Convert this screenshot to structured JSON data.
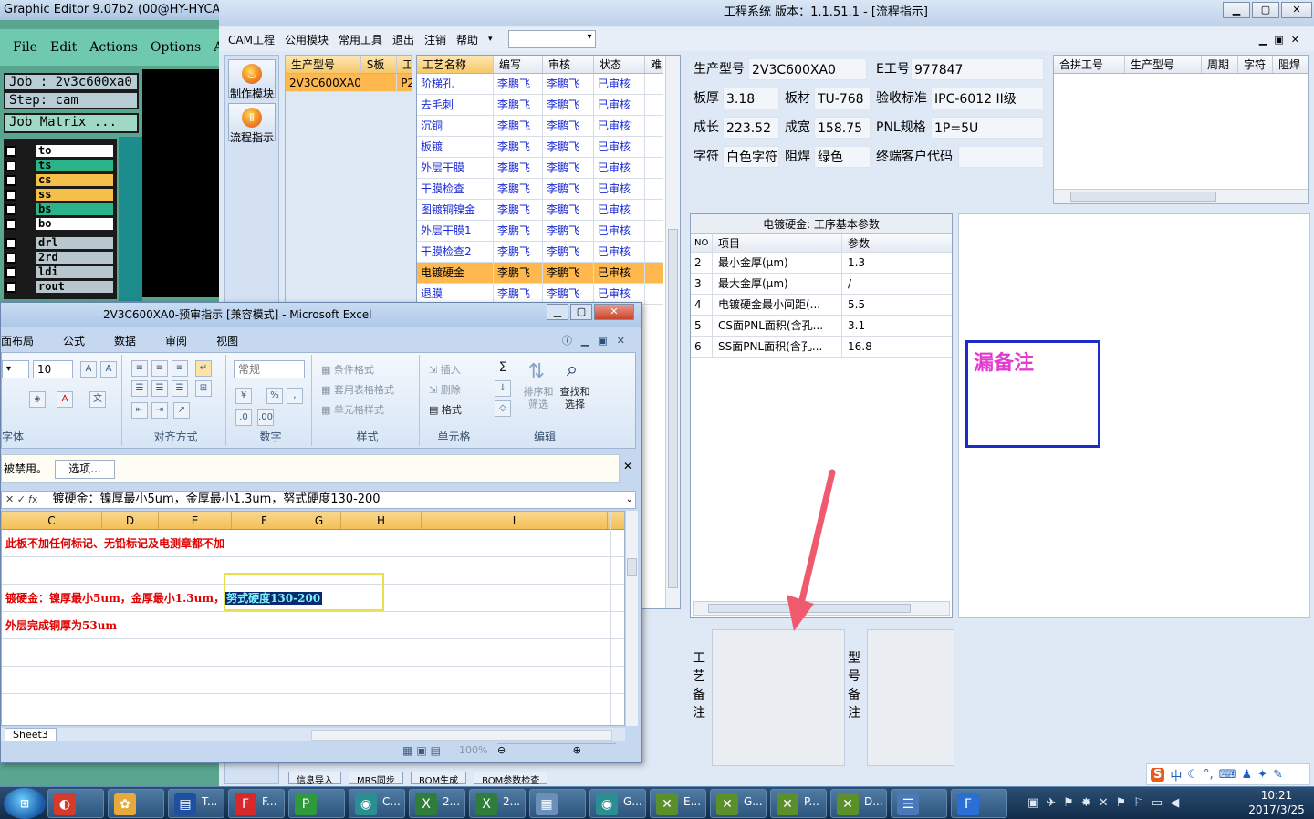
{
  "graphic_editor": {
    "title": "Graphic Editor 9.07b2 (00@HY-HYCA",
    "menu": [
      "File",
      "Edit",
      "Actions",
      "Options",
      "A"
    ],
    "job": "Job  : 2v3c600xa0",
    "step": "Step: cam",
    "matrix": "Job Matrix ...",
    "layers": [
      {
        "name": "to",
        "color": "#ffffff"
      },
      {
        "name": "ts",
        "color": "#2bb48a"
      },
      {
        "name": "cs",
        "color": "#f4c04a"
      },
      {
        "name": "ss",
        "color": "#f4c04a"
      },
      {
        "name": "bs",
        "color": "#2bb48a"
      },
      {
        "name": "bo",
        "color": "#ffffff"
      }
    ],
    "drill_layers": [
      "drl",
      "2rd",
      "ldi",
      "rout"
    ]
  },
  "cam": {
    "title": "工程系统   版本：1.1.51.1 - [流程指示]",
    "menu": [
      "CAM工程",
      "公用模块",
      "常用工具",
      "退出",
      "注销",
      "帮助"
    ],
    "sidebar": [
      {
        "label": "制作模块",
        "icon": "fire-icon"
      },
      {
        "label": "流程指示",
        "icon": "flow-icon"
      }
    ],
    "model_grid": {
      "headers": [
        "生产型号",
        "S板",
        "工"
      ],
      "rows": [
        [
          "2V3C600XA0",
          "",
          "P2"
        ]
      ]
    },
    "process_grid": {
      "headers": [
        "工艺名称",
        "编写",
        "审核",
        "状态",
        "难"
      ],
      "rows": [
        [
          "阶梯孔",
          "李鹏飞",
          "李鹏飞",
          "已审核"
        ],
        [
          "去毛刺",
          "李鹏飞",
          "李鹏飞",
          "已审核"
        ],
        [
          "沉铜",
          "李鹏飞",
          "李鹏飞",
          "已审核"
        ],
        [
          "板镀",
          "李鹏飞",
          "李鹏飞",
          "已审核"
        ],
        [
          "外层干膜",
          "李鹏飞",
          "李鹏飞",
          "已审核"
        ],
        [
          "干膜检查",
          "李鹏飞",
          "李鹏飞",
          "已审核"
        ],
        [
          "图镀铜镍金",
          "李鹏飞",
          "李鹏飞",
          "已审核"
        ],
        [
          "外层干膜1",
          "李鹏飞",
          "李鹏飞",
          "已审核"
        ],
        [
          "干膜检查2",
          "李鹏飞",
          "李鹏飞",
          "已审核"
        ],
        [
          "电镀硬金",
          "李鹏飞",
          "李鹏飞",
          "已审核"
        ],
        [
          "退膜",
          "李鹏飞",
          "李鹏飞",
          "已审核"
        ]
      ],
      "selected_index": 9
    },
    "info": {
      "model_label": "生产型号",
      "model": "2V3C600XA0",
      "eng_label": "E工号",
      "eng": "977847",
      "thick_label": "板厚",
      "thick": "3.18",
      "material_label": "板材",
      "material": "TU-768",
      "standard_label": "验收标准",
      "standard": "IPC-6012 II级",
      "length_label": "成长",
      "length": "223.52",
      "width_label": "成宽",
      "width": "158.75",
      "pnl_label": "PNL规格",
      "pnl": "1P=5U",
      "char_label": "字符",
      "char": "白色字符",
      "mask_label": "阻焊",
      "mask": "绿色",
      "customer_label": "终端客户代码",
      "customer": ""
    },
    "merge_grid": {
      "headers": [
        "合拼工号",
        "生产型号",
        "周期",
        "字符",
        "阻焊"
      ]
    },
    "param_grid": {
      "title": "电镀硬金: 工序基本参数",
      "headers": [
        "NO",
        "项目",
        "参数"
      ],
      "rows": [
        [
          "2",
          "最小金厚(μm)",
          "1.3"
        ],
        [
          "3",
          "最大金厚(μm)",
          "/"
        ],
        [
          "4",
          "电镀硬金最小间距(...",
          "5.5"
        ],
        [
          "5",
          "CS面PNL面积(含孔...",
          "3.1"
        ],
        [
          "6",
          "SS面PNL面积(含孔...",
          "16.8"
        ]
      ]
    },
    "note_text": "漏备注",
    "process_remark_label": "工艺备注",
    "model_remark_label": "型号备注",
    "bottom_buttons": [
      "信息导入",
      "MRS同步",
      "BOM生成",
      "BOM参数检查"
    ]
  },
  "excel": {
    "title": "2V3C600XA0-预审指示 [兼容模式] - Microsoft Excel",
    "tabs": [
      "面布局",
      "公式",
      "数据",
      "审阅",
      "视图"
    ],
    "font_size": "10",
    "number_format": "常规",
    "groups": [
      "字体",
      "对齐方式",
      "数字",
      "样式",
      "单元格",
      "编辑"
    ],
    "style_items": [
      "条件格式",
      "套用表格格式",
      "单元格样式"
    ],
    "cell_items": [
      "插入",
      "删除",
      "格式"
    ],
    "edit_items": [
      "排序和筛选",
      "查找和选择"
    ],
    "edit_item_lines": [
      "排序和",
      "筛选",
      "查找和",
      "选择"
    ],
    "message": "被禁用。",
    "options_button": "选项...",
    "formula": "镀硬金：镍厚最小5um，金厚最小1.3um，努式硬度130-200",
    "columns": [
      "C",
      "D",
      "E",
      "F",
      "G",
      "H",
      "I"
    ],
    "rows": [
      "此板不加任何标记、无铅标记及电测章都不加",
      "",
      "镀硬金：镍厚最小5um，金厚最小1.3um，",
      "外层完成铜厚为53um",
      "",
      "",
      ""
    ],
    "highlight": "努式硬度130-200",
    "sheet_tab": "Sheet3",
    "zoom": "100%"
  },
  "taskbar": {
    "items": [
      {
        "label": "",
        "icon": "office-icon",
        "color": "#d63a2b"
      },
      {
        "label": "",
        "icon": "folder-icon",
        "color": "#e7a93a"
      },
      {
        "label": "T...",
        "icon": "save-icon",
        "color": "#1f4fa0"
      },
      {
        "label": "F...",
        "icon": "f-icon",
        "color": "#d8282a"
      },
      {
        "label": "",
        "icon": "p-icon",
        "color": "#2e9a3b"
      },
      {
        "label": "C...",
        "icon": "eye-icon",
        "color": "#2a8f93"
      },
      {
        "label": "2...",
        "icon": "excel-icon",
        "color": "#2f7d3a"
      },
      {
        "label": "2...",
        "icon": "excel-icon",
        "color": "#2f7d3a"
      },
      {
        "label": "",
        "icon": "calc-icon",
        "color": "#6b8fb8"
      },
      {
        "label": "G...",
        "icon": "eye-icon",
        "color": "#2a8f93"
      },
      {
        "label": "E...",
        "icon": "x-icon",
        "color": "#5b8f2a"
      },
      {
        "label": "G...",
        "icon": "x-icon",
        "color": "#5b8f2a"
      },
      {
        "label": "P...",
        "icon": "x-icon",
        "color": "#5b8f2a"
      },
      {
        "label": "D...",
        "icon": "x-icon",
        "color": "#5b8f2a"
      },
      {
        "label": "",
        "icon": "notepad-icon",
        "color": "#4a78b8"
      },
      {
        "label": "",
        "icon": "f-icon",
        "color": "#2a6fd6"
      }
    ],
    "time": "10:21",
    "date": "2017/3/25",
    "ime": "中"
  }
}
